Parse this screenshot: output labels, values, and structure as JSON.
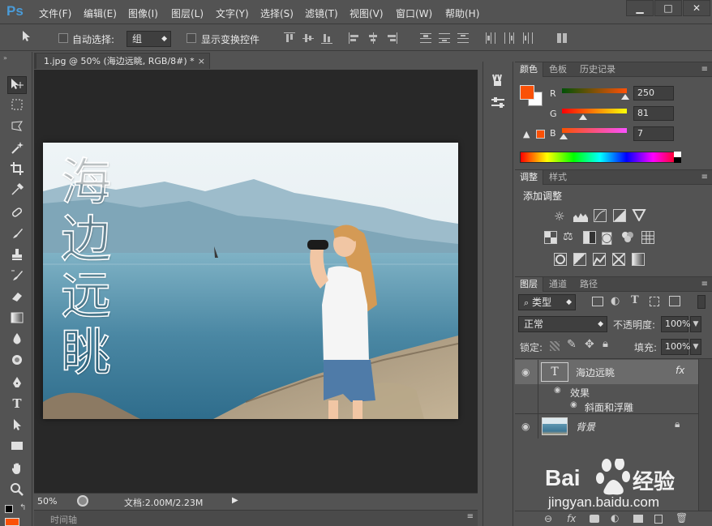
{
  "app": {
    "logo": "Ps"
  },
  "menu": [
    "文件(F)",
    "编辑(E)",
    "图像(I)",
    "图层(L)",
    "文字(Y)",
    "选择(S)",
    "滤镜(T)",
    "视图(V)",
    "窗口(W)",
    "帮助(H)"
  ],
  "window_controls": {
    "minimize": "▁",
    "maximize": "□",
    "close": "✕"
  },
  "options": {
    "auto_select_label": "自动选择:",
    "auto_select_value": "组",
    "show_transform_label": "显示变换控件"
  },
  "document": {
    "tab_title": "1.jpg @ 50% (海边远眺, RGB/8#) *",
    "tab_close": "×",
    "overlay_text": [
      "海",
      "边",
      "远",
      "眺"
    ]
  },
  "status": {
    "zoom": "50%",
    "doc_size": "文档:2.00M/2.23M"
  },
  "timeline": {
    "label": "时间轴"
  },
  "color_panel": {
    "tabs": [
      "颜色",
      "色板",
      "历史记录"
    ],
    "channels": [
      {
        "label": "R",
        "value": "250",
        "fraction": 0.98
      },
      {
        "label": "G",
        "value": "81",
        "fraction": 0.32
      },
      {
        "label": "B",
        "value": "7",
        "fraction": 0.03
      }
    ],
    "foreground_color": "#fa5107",
    "background_color": "#ffffff"
  },
  "adjust_panel": {
    "tabs": [
      "调整",
      "样式"
    ],
    "title": "添加调整"
  },
  "layers_panel": {
    "tabs": [
      "图层",
      "通道",
      "路径"
    ],
    "filter_kind": "类型",
    "blend_mode": "正常",
    "opacity_label": "不透明度:",
    "opacity_value": "100%",
    "lock_label": "锁定:",
    "fill_label": "填充:",
    "fill_value": "100%",
    "layers": [
      {
        "name": "海边远眺",
        "type": "text",
        "fx": "fx"
      },
      {
        "name": "效果",
        "type": "effects"
      },
      {
        "name": "斜面和浮雕",
        "type": "effect"
      },
      {
        "name": "背景",
        "type": "image"
      }
    ]
  },
  "watermark": {
    "brand": "Bai",
    "brand2": "经验",
    "url": "jingyan.baidu.com"
  }
}
